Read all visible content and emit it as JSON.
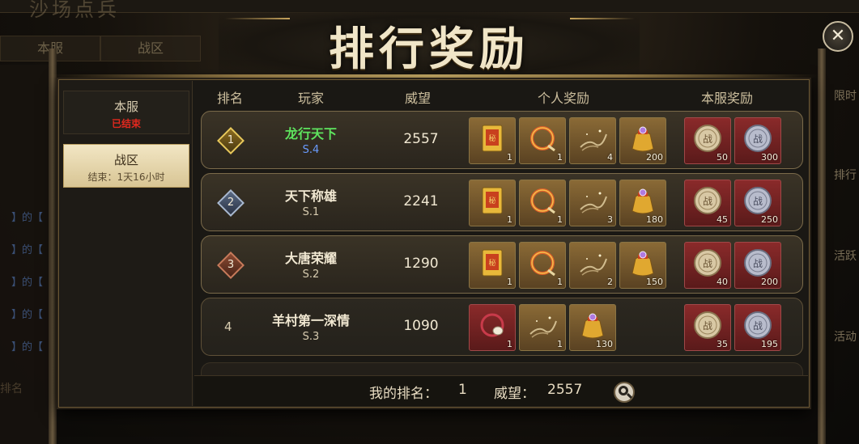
{
  "window": {
    "title": "排行奖励",
    "close_icon": "close-icon"
  },
  "sidebar": [
    {
      "label": "本服",
      "sub": "已结束"
    },
    {
      "label": "战区",
      "sub": "结束：1天16小时"
    }
  ],
  "columns": [
    "排名",
    "玩家",
    "威望",
    "个人奖励",
    "本服奖励"
  ],
  "rows": [
    {
      "rank": "1",
      "name": "龙行天下",
      "server": "S.4",
      "prestige": "2557",
      "personal": [
        {
          "icon": "golden-book-icon",
          "qty": "1"
        },
        {
          "icon": "fire-ring-icon",
          "qty": "1"
        },
        {
          "icon": "silk-scroll-icon",
          "qty": "4"
        },
        {
          "icon": "gold-pouch-icon",
          "qty": "200"
        }
      ],
      "server_rewards": [
        {
          "icon": "bronze-medal-icon",
          "qty": "50"
        },
        {
          "icon": "silver-medal-icon",
          "qty": "300"
        }
      ]
    },
    {
      "rank": "2",
      "name": "天下称雄",
      "server": "S.1",
      "prestige": "2241",
      "personal": [
        {
          "icon": "golden-book-icon",
          "qty": "1"
        },
        {
          "icon": "fire-ring-icon",
          "qty": "1"
        },
        {
          "icon": "silk-scroll-icon",
          "qty": "3"
        },
        {
          "icon": "gold-pouch-icon",
          "qty": "180"
        }
      ],
      "server_rewards": [
        {
          "icon": "bronze-medal-icon",
          "qty": "45"
        },
        {
          "icon": "silver-medal-icon",
          "qty": "250"
        }
      ]
    },
    {
      "rank": "3",
      "name": "大唐荣耀",
      "server": "S.2",
      "prestige": "1290",
      "personal": [
        {
          "icon": "golden-book-icon",
          "qty": "1"
        },
        {
          "icon": "fire-ring-icon",
          "qty": "1"
        },
        {
          "icon": "silk-scroll-icon",
          "qty": "2"
        },
        {
          "icon": "gold-pouch-icon",
          "qty": "150"
        }
      ],
      "server_rewards": [
        {
          "icon": "bronze-medal-icon",
          "qty": "40"
        },
        {
          "icon": "silver-medal-icon",
          "qty": "200"
        }
      ]
    },
    {
      "rank": "4",
      "name": "羊村第一深情",
      "server": "S.3",
      "prestige": "1090",
      "personal": [
        {
          "icon": "pearl-ring-icon",
          "qty": "1"
        },
        {
          "icon": "silk-scroll-icon",
          "qty": "1"
        },
        {
          "icon": "gold-pouch-icon",
          "qty": "130"
        }
      ],
      "server_rewards": [
        {
          "icon": "bronze-medal-icon",
          "qty": "35"
        },
        {
          "icon": "silver-medal-icon",
          "qty": "195"
        }
      ]
    }
  ],
  "footer": {
    "my_rank_label": "我的排名：",
    "my_rank": "1",
    "prestige_label": "威望：",
    "prestige": "2557"
  },
  "background": {
    "tabs": [
      "本服",
      "战区"
    ],
    "right_buttons": [
      "限时",
      "排行",
      "活跃",
      "活动"
    ],
    "search_hint": "排名",
    "title_fragment": "沙场点兵"
  },
  "colors": {
    "rank1_name": "#5ee35e",
    "rank1_server": "#6a9cff",
    "ended_red": "#e0281e"
  }
}
